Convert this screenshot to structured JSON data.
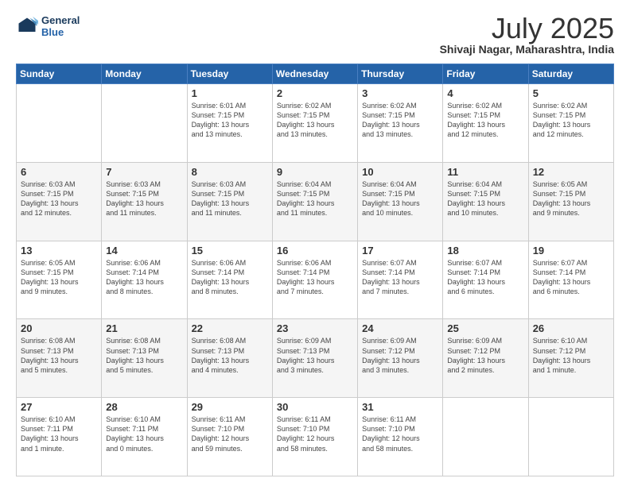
{
  "header": {
    "logo_line1": "General",
    "logo_line2": "Blue",
    "month": "July 2025",
    "location": "Shivaji Nagar, Maharashtra, India"
  },
  "days_of_week": [
    "Sunday",
    "Monday",
    "Tuesday",
    "Wednesday",
    "Thursday",
    "Friday",
    "Saturday"
  ],
  "weeks": [
    [
      {
        "day": "",
        "info": ""
      },
      {
        "day": "",
        "info": ""
      },
      {
        "day": "1",
        "info": "Sunrise: 6:01 AM\nSunset: 7:15 PM\nDaylight: 13 hours\nand 13 minutes."
      },
      {
        "day": "2",
        "info": "Sunrise: 6:02 AM\nSunset: 7:15 PM\nDaylight: 13 hours\nand 13 minutes."
      },
      {
        "day": "3",
        "info": "Sunrise: 6:02 AM\nSunset: 7:15 PM\nDaylight: 13 hours\nand 13 minutes."
      },
      {
        "day": "4",
        "info": "Sunrise: 6:02 AM\nSunset: 7:15 PM\nDaylight: 13 hours\nand 12 minutes."
      },
      {
        "day": "5",
        "info": "Sunrise: 6:02 AM\nSunset: 7:15 PM\nDaylight: 13 hours\nand 12 minutes."
      }
    ],
    [
      {
        "day": "6",
        "info": "Sunrise: 6:03 AM\nSunset: 7:15 PM\nDaylight: 13 hours\nand 12 minutes."
      },
      {
        "day": "7",
        "info": "Sunrise: 6:03 AM\nSunset: 7:15 PM\nDaylight: 13 hours\nand 11 minutes."
      },
      {
        "day": "8",
        "info": "Sunrise: 6:03 AM\nSunset: 7:15 PM\nDaylight: 13 hours\nand 11 minutes."
      },
      {
        "day": "9",
        "info": "Sunrise: 6:04 AM\nSunset: 7:15 PM\nDaylight: 13 hours\nand 11 minutes."
      },
      {
        "day": "10",
        "info": "Sunrise: 6:04 AM\nSunset: 7:15 PM\nDaylight: 13 hours\nand 10 minutes."
      },
      {
        "day": "11",
        "info": "Sunrise: 6:04 AM\nSunset: 7:15 PM\nDaylight: 13 hours\nand 10 minutes."
      },
      {
        "day": "12",
        "info": "Sunrise: 6:05 AM\nSunset: 7:15 PM\nDaylight: 13 hours\nand 9 minutes."
      }
    ],
    [
      {
        "day": "13",
        "info": "Sunrise: 6:05 AM\nSunset: 7:15 PM\nDaylight: 13 hours\nand 9 minutes."
      },
      {
        "day": "14",
        "info": "Sunrise: 6:06 AM\nSunset: 7:14 PM\nDaylight: 13 hours\nand 8 minutes."
      },
      {
        "day": "15",
        "info": "Sunrise: 6:06 AM\nSunset: 7:14 PM\nDaylight: 13 hours\nand 8 minutes."
      },
      {
        "day": "16",
        "info": "Sunrise: 6:06 AM\nSunset: 7:14 PM\nDaylight: 13 hours\nand 7 minutes."
      },
      {
        "day": "17",
        "info": "Sunrise: 6:07 AM\nSunset: 7:14 PM\nDaylight: 13 hours\nand 7 minutes."
      },
      {
        "day": "18",
        "info": "Sunrise: 6:07 AM\nSunset: 7:14 PM\nDaylight: 13 hours\nand 6 minutes."
      },
      {
        "day": "19",
        "info": "Sunrise: 6:07 AM\nSunset: 7:14 PM\nDaylight: 13 hours\nand 6 minutes."
      }
    ],
    [
      {
        "day": "20",
        "info": "Sunrise: 6:08 AM\nSunset: 7:13 PM\nDaylight: 13 hours\nand 5 minutes."
      },
      {
        "day": "21",
        "info": "Sunrise: 6:08 AM\nSunset: 7:13 PM\nDaylight: 13 hours\nand 5 minutes."
      },
      {
        "day": "22",
        "info": "Sunrise: 6:08 AM\nSunset: 7:13 PM\nDaylight: 13 hours\nand 4 minutes."
      },
      {
        "day": "23",
        "info": "Sunrise: 6:09 AM\nSunset: 7:13 PM\nDaylight: 13 hours\nand 3 minutes."
      },
      {
        "day": "24",
        "info": "Sunrise: 6:09 AM\nSunset: 7:12 PM\nDaylight: 13 hours\nand 3 minutes."
      },
      {
        "day": "25",
        "info": "Sunrise: 6:09 AM\nSunset: 7:12 PM\nDaylight: 13 hours\nand 2 minutes."
      },
      {
        "day": "26",
        "info": "Sunrise: 6:10 AM\nSunset: 7:12 PM\nDaylight: 13 hours\nand 1 minute."
      }
    ],
    [
      {
        "day": "27",
        "info": "Sunrise: 6:10 AM\nSunset: 7:11 PM\nDaylight: 13 hours\nand 1 minute."
      },
      {
        "day": "28",
        "info": "Sunrise: 6:10 AM\nSunset: 7:11 PM\nDaylight: 13 hours\nand 0 minutes."
      },
      {
        "day": "29",
        "info": "Sunrise: 6:11 AM\nSunset: 7:10 PM\nDaylight: 12 hours\nand 59 minutes."
      },
      {
        "day": "30",
        "info": "Sunrise: 6:11 AM\nSunset: 7:10 PM\nDaylight: 12 hours\nand 58 minutes."
      },
      {
        "day": "31",
        "info": "Sunrise: 6:11 AM\nSunset: 7:10 PM\nDaylight: 12 hours\nand 58 minutes."
      },
      {
        "day": "",
        "info": ""
      },
      {
        "day": "",
        "info": ""
      }
    ]
  ]
}
